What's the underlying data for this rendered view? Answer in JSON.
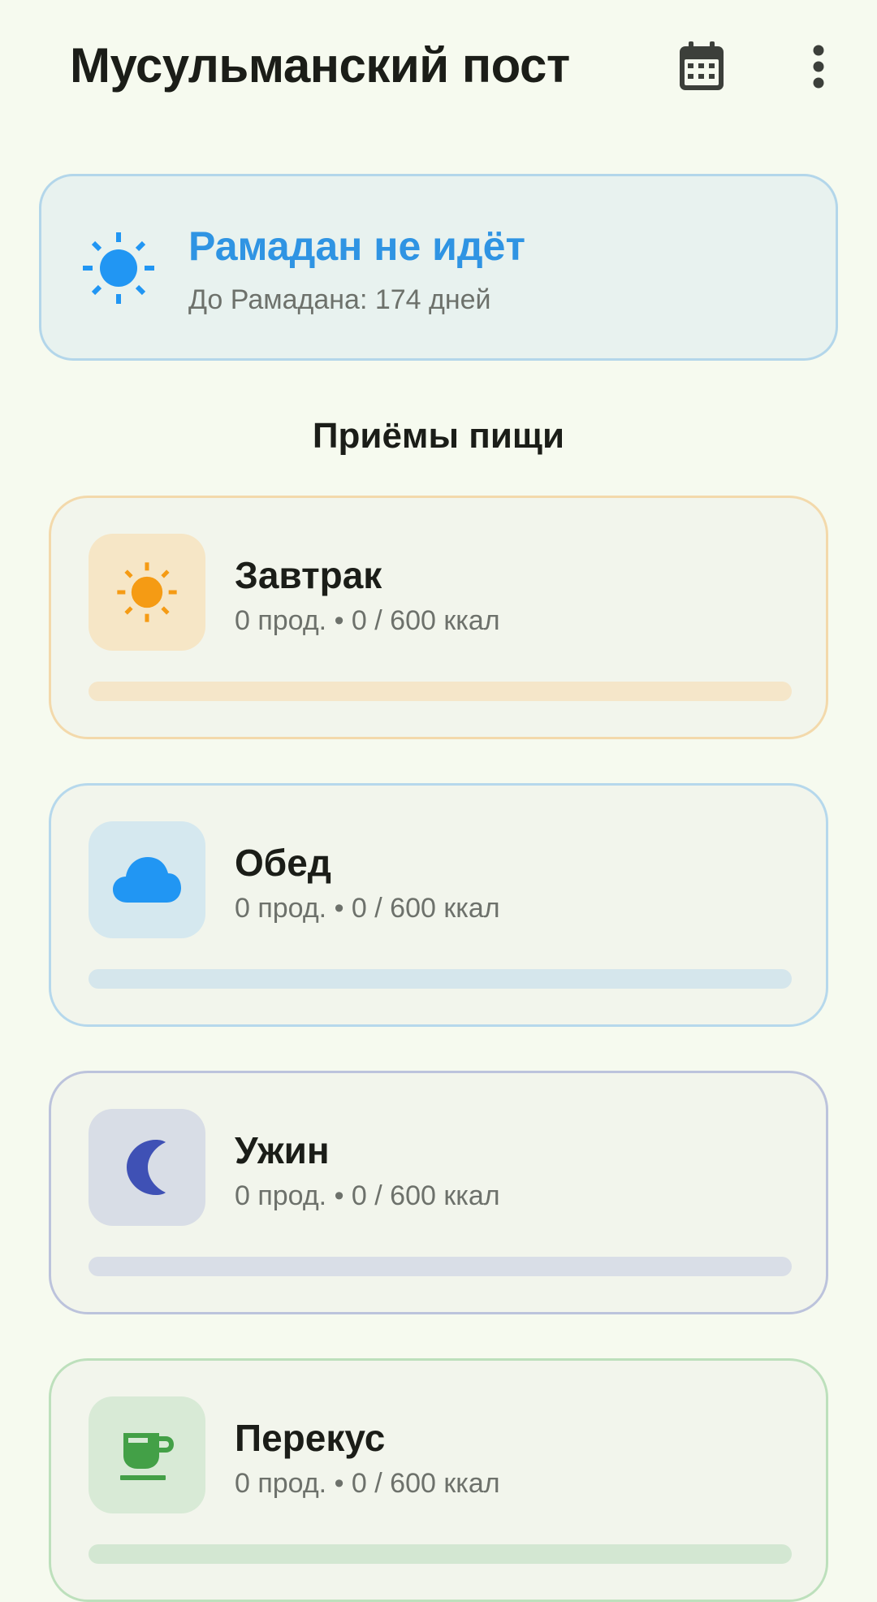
{
  "app": {
    "title": "Мусульманский пост"
  },
  "status": {
    "title": "Рамадан не идёт",
    "subtitle": "До Рамадана: 174 дней",
    "icon": "sun-icon",
    "color": "#2f94e3"
  },
  "section": {
    "title": "Приёмы пищи"
  },
  "meals": [
    {
      "name": "Завтрак",
      "summary": "0 прод. • 0 / 600 ккал",
      "icon": "sun-icon",
      "accent": "#f59b14",
      "progress": 0
    },
    {
      "name": "Обед",
      "summary": "0 прод. • 0 / 600 ккал",
      "icon": "cloud-icon",
      "accent": "#2196f3",
      "progress": 0
    },
    {
      "name": "Ужин",
      "summary": "0 прод. • 0 / 600 ккал",
      "icon": "moon-icon",
      "accent": "#3f51b5",
      "progress": 0
    },
    {
      "name": "Перекус",
      "summary": "0 прод. • 0 / 600 ккал",
      "icon": "cup-icon",
      "accent": "#43a047",
      "progress": 0
    }
  ]
}
